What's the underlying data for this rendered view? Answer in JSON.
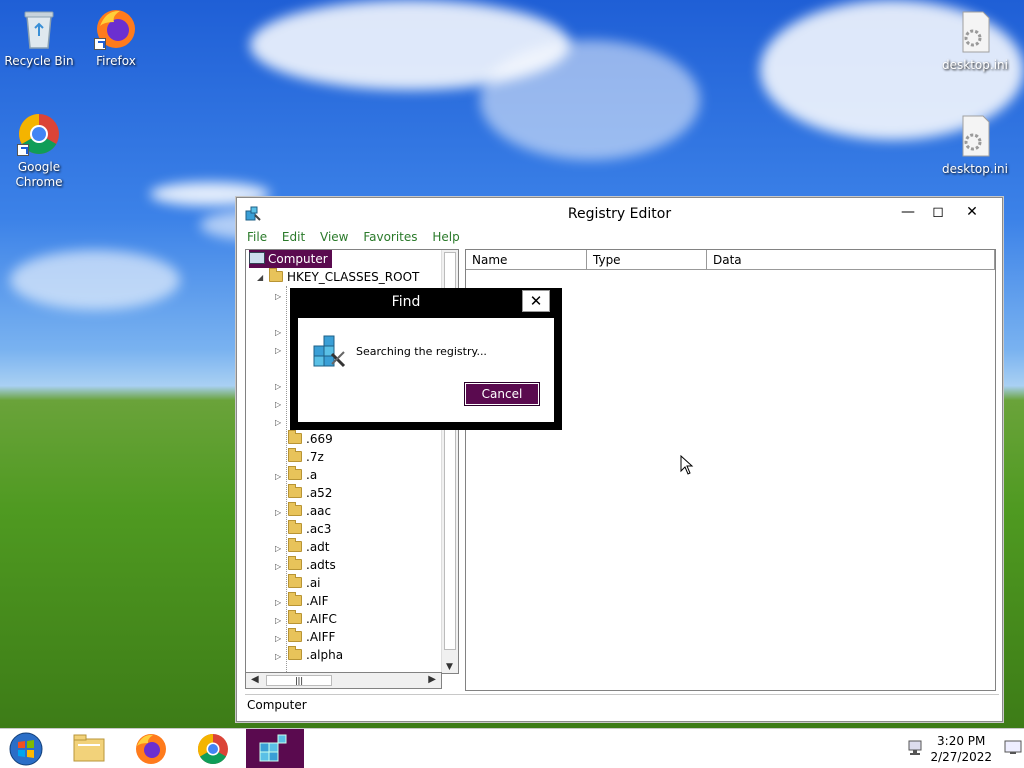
{
  "desktop": {
    "icons": [
      {
        "label": "Recycle Bin",
        "icon": "recycle-bin-icon"
      },
      {
        "label": "Firefox",
        "icon": "firefox-icon"
      },
      {
        "label": "Google Chrome",
        "icon": "chrome-icon"
      },
      {
        "label": "desktop.ini",
        "icon": "settings-file-icon"
      },
      {
        "label": "desktop.ini",
        "icon": "settings-file-icon"
      }
    ]
  },
  "regedit": {
    "title": "Registry Editor",
    "menu": [
      "File",
      "Edit",
      "View",
      "Favorites",
      "Help"
    ],
    "tree": {
      "root": "Computer",
      "hive": "HKEY_CLASSES_ROOT",
      "keys": [
        ".669",
        ".7z",
        ".a",
        ".a52",
        ".aac",
        ".ac3",
        ".adt",
        ".adts",
        ".ai",
        ".AIF",
        ".AIFC",
        ".AIFF",
        ".alpha"
      ]
    },
    "columns": [
      "Name",
      "Type",
      "Data"
    ],
    "status": "Computer"
  },
  "find_dialog": {
    "title": "Find",
    "message": "Searching the registry...",
    "cancel_label": "Cancel"
  },
  "taskbar": {
    "time": "3:20 PM",
    "date": "2/27/2022"
  },
  "colors": {
    "dialog_accent": "#5a0a4f",
    "menu_text": "#2a7a2a"
  }
}
